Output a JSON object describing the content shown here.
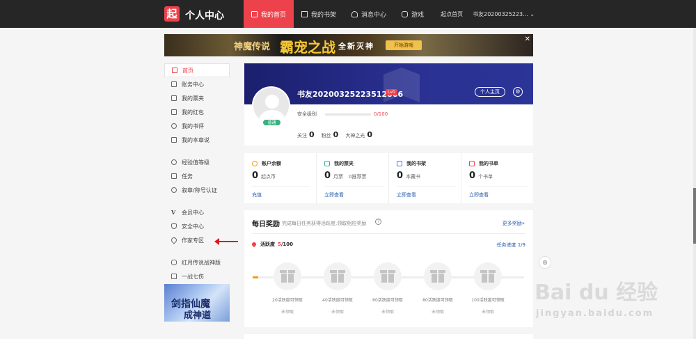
{
  "header": {
    "logo_char": "起",
    "title": "个人中心",
    "nav": [
      {
        "label": "我的首页",
        "active": true
      },
      {
        "label": "我的书架",
        "active": false
      },
      {
        "label": "消息中心",
        "active": false
      },
      {
        "label": "游戏",
        "active": false
      }
    ],
    "right_link": "起点首页",
    "user": "书友20200325223... ⌄"
  },
  "banner": {
    "t1": "神魔传说",
    "t2": "霸宠之战",
    "t3": "全新灭神",
    "button": "开始游戏",
    "close": "✕"
  },
  "sidebar": {
    "group1": [
      "首页",
      "账务中心",
      "我的票夹",
      "我的红包",
      "我的书评",
      "我的本章说"
    ],
    "group2": [
      "经验值等级",
      "任务",
      "叙章/称号认证"
    ],
    "group3": [
      "会员中心",
      "安全中心",
      "作家专区"
    ],
    "group4": [
      "红月传说战神版",
      "一战七伤"
    ],
    "banner_t1": "剑指仙魔",
    "banner_t2": "成神道"
  },
  "profile": {
    "username": "书友20200325223512866",
    "level": "Lv0",
    "badge": "普通",
    "home_button": "个人主页",
    "security_label": "安全级别",
    "security_value": "0/100",
    "following_label": "关注",
    "following": "0",
    "fans_label": "粉丝",
    "fans": "0",
    "light_label": "大神之光",
    "light": "0"
  },
  "cards": [
    {
      "title": "账户余额",
      "value": "0",
      "unit": "起点币",
      "extra": "",
      "link": "充值",
      "color": "#f39c12"
    },
    {
      "title": "我的票夹",
      "value": "0",
      "unit": "月票",
      "extra": "0推荐票",
      "link": "立即查看",
      "color": "#36b2a8"
    },
    {
      "title": "我的书架",
      "value": "0",
      "unit": "本藏书",
      "extra": "",
      "link": "立即查看",
      "color": "#3b7bd4"
    },
    {
      "title": "我的书单",
      "value": "0",
      "unit": "个书单",
      "extra": "",
      "link": "立即查看",
      "color": "#ed424b"
    }
  ],
  "daily": {
    "title": "每日奖励",
    "subtitle": "完成每日任务获得活跃度,领取相应奖励",
    "more": "更多奖励»",
    "activity_label": "活跃度",
    "activity_value": "5",
    "activity_total": "/100",
    "progress_label": "任务进度 1/9",
    "progress": 0.02,
    "gifts": [
      {
        "label": "20活跃度可领取",
        "status": "未领取"
      },
      {
        "label": "40活跃度可领取",
        "status": "未领取"
      },
      {
        "label": "60活跃度可领取",
        "status": "未领取"
      },
      {
        "label": "80活跃度可领取",
        "status": "未领取"
      },
      {
        "label": "100活跃度可领取",
        "status": "未领取"
      }
    ]
  },
  "watermark": {
    "text": "Bai du 经验",
    "url": "jingyan.baidu.com"
  }
}
